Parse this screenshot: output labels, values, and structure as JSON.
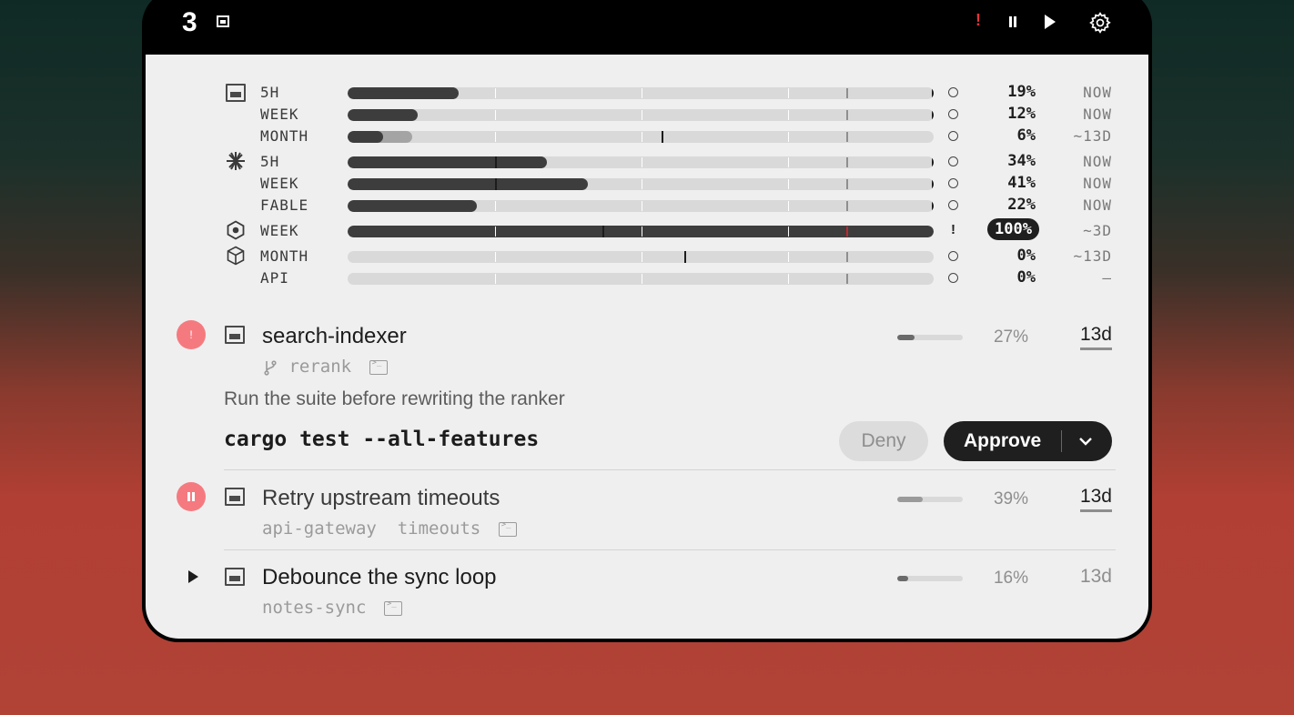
{
  "topbar": {
    "count": "3",
    "alert_glyph": "!",
    "icons": [
      "window-icon",
      "alert-icon",
      "pause-icon",
      "play-icon",
      "gear-icon"
    ]
  },
  "usage": {
    "rows": [
      {
        "provider_icon": "window-icon",
        "label": "5H",
        "percent": "19%",
        "eta": "NOW",
        "fill": 0.19,
        "status": "circle"
      },
      {
        "label": "WEEK",
        "percent": "12%",
        "eta": "NOW",
        "fill": 0.12,
        "status": "circle"
      },
      {
        "label": "MONTH",
        "percent": "6%",
        "eta": "~13D",
        "fill": 0.06,
        "secondary_fill": 0.11,
        "status": "circle"
      },
      {
        "provider_icon": "asterisk-icon",
        "label": "5H",
        "percent": "34%",
        "eta": "NOW",
        "fill": 0.34,
        "status": "circle"
      },
      {
        "label": "WEEK",
        "percent": "41%",
        "eta": "NOW",
        "fill": 0.41,
        "status": "circle"
      },
      {
        "label": "FABLE",
        "percent": "22%",
        "eta": "NOW",
        "fill": 0.22,
        "status": "circle"
      },
      {
        "provider_icon": "hexagon-icon",
        "label": "WEEK",
        "percent": "100%",
        "eta": "~3D",
        "fill": 1.0,
        "status": "!"
      },
      {
        "provider_icon": "cube-icon",
        "label": "MONTH",
        "percent": "0%",
        "eta": "~13D",
        "fill": 0.0,
        "status": "circle"
      },
      {
        "label": "API",
        "percent": "0%",
        "eta": "—",
        "fill": 0.0,
        "status": "circle"
      }
    ]
  },
  "tasks": [
    {
      "title": "search-indexer",
      "branch": "rerank",
      "percent": "27%",
      "progress": 0.27,
      "due": "13d",
      "status": "alert",
      "status_glyph": "!",
      "prompt": "Run the suite before rewriting the ranker",
      "command": "cargo test --all-features",
      "deny_label": "Deny",
      "approve_label": "Approve"
    },
    {
      "title": "Retry upstream timeouts",
      "project": "api-gateway",
      "branch": "timeouts",
      "percent": "39%",
      "progress": 0.39,
      "due": "13d",
      "status": "paused"
    },
    {
      "title": "Debounce the sync loop",
      "project": "notes-sync",
      "percent": "16%",
      "progress": 0.16,
      "due": "13d",
      "status": "queued"
    }
  ],
  "colors": {
    "bar_fill": "#3d3d3d",
    "bar_track": "#d9d9d9",
    "alert_red": "#e0353a",
    "status_pink": "#f57a80",
    "panel_bg": "#efefef"
  }
}
